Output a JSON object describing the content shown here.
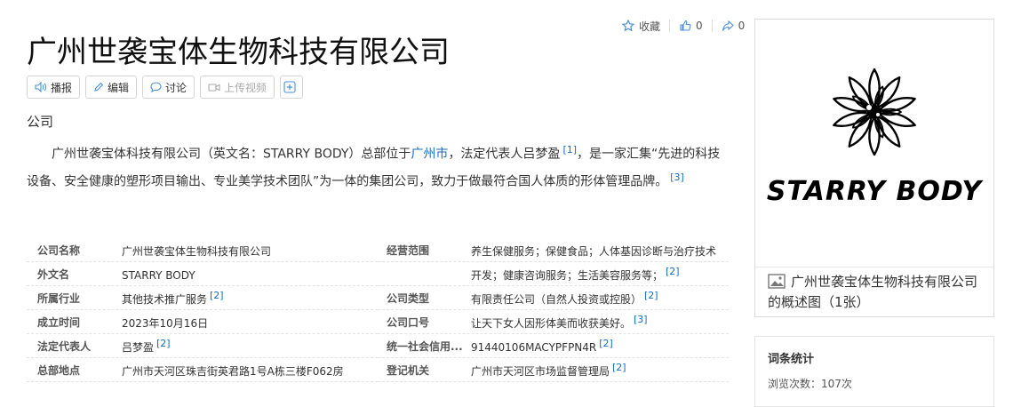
{
  "actions": {
    "favorite_label": "收藏",
    "like_count": "0",
    "share_count": "0"
  },
  "title": "广州世袭宝体生物科技有限公司",
  "toolbar": {
    "broadcast": "播报",
    "edit": "编辑",
    "discuss": "讨论",
    "upload_video": "上传视频"
  },
  "category": "公司",
  "summary": {
    "part1": "广州世袭宝体科技有限公司（英文名：STARRY BODY）总部位于",
    "link_city": "广州市",
    "part2": "，法定代表人吕梦盈",
    "ref1": "[1]",
    "part3": "，是一家汇集“先进的科技设备、安全健康的塑形项目输出、专业美学技术团队”为一体的集团公司，致力于做最符合国人体质的形体管理品牌。",
    "ref2": "[3]"
  },
  "info_left": [
    {
      "label": "公司名称",
      "value": "广州世袭宝体生物科技有限公司",
      "ref": ""
    },
    {
      "label": "外文名",
      "value": "STARRY BODY",
      "ref": ""
    },
    {
      "label": "所属行业",
      "value": "其他技术推广服务",
      "ref": "[2]"
    },
    {
      "label": "成立时间",
      "value": "2023年10月16日",
      "ref": ""
    },
    {
      "label": "法定代表人",
      "value": "吕梦盈",
      "ref": "[2]"
    },
    {
      "label": "总部地点",
      "value": "广州市天河区珠吉街英君路1号A栋三楼F062房",
      "ref": ""
    }
  ],
  "info_right": [
    {
      "label": "经营范围",
      "value": "养生保健服务；保健食品；人体基因诊断与治疗技术",
      "ref": ""
    },
    {
      "label": "",
      "value": "开发；健康咨询服务；生活美容服务等；",
      "ref": "[2]"
    },
    {
      "label": "公司类型",
      "value": "有限责任公司（自然人投资或控股）",
      "ref": "[2]"
    },
    {
      "label": "公司口号",
      "value": "让天下女人因形体美而收获美好。",
      "ref": "[3]"
    },
    {
      "label": "统一社会信用...",
      "value": "91440106MACYPFPN4R",
      "ref": "[2]"
    },
    {
      "label": "登记机关",
      "value": "广州市天河区市场监督管理局",
      "ref": "[2]"
    }
  ],
  "image_card": {
    "brand_text": "STARRY BODY",
    "caption": "广州世袭宝体生物科技有限公司的概述图（1张）"
  },
  "stats": {
    "title": "词条统计",
    "views": "浏览次数：107次"
  }
}
